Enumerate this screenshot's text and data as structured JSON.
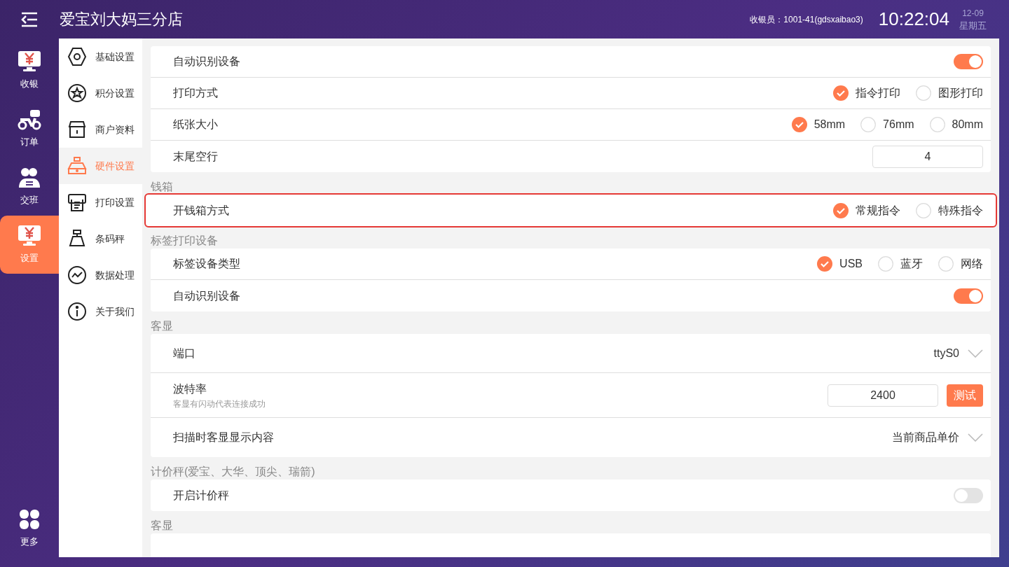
{
  "header": {
    "store_name": "爱宝刘大妈三分店",
    "cashier": "收银员：1001-41(gdsxaibao3)",
    "time": "10:22:04",
    "date": "12-09",
    "weekday": "星期五"
  },
  "rail": [
    {
      "label": "收银",
      "selected": false
    },
    {
      "label": "订单",
      "selected": false
    },
    {
      "label": "交班",
      "selected": false
    },
    {
      "label": "设置",
      "selected": true
    },
    {
      "label": "更多",
      "selected": false
    }
  ],
  "settings_nav": [
    {
      "label": "基础设置",
      "selected": false
    },
    {
      "label": "积分设置",
      "selected": false
    },
    {
      "label": "商户资料",
      "selected": false
    },
    {
      "label": "硬件设置",
      "selected": true
    },
    {
      "label": "打印设置",
      "selected": false
    },
    {
      "label": "条码秤",
      "selected": false
    },
    {
      "label": "数据处理",
      "selected": false
    },
    {
      "label": "关于我们",
      "selected": false
    }
  ],
  "sections": [
    {
      "highlighted": false,
      "rows": [
        {
          "kind": "toggle",
          "label": "自动识别设备",
          "on": true
        },
        {
          "kind": "radio",
          "label": "打印方式",
          "options": [
            {
              "label": "指令打印",
              "selected": true
            },
            {
              "label": "图形打印",
              "selected": false
            }
          ]
        },
        {
          "kind": "radio",
          "label": "纸张大小",
          "options": [
            {
              "label": "58mm",
              "selected": true
            },
            {
              "label": "76mm",
              "selected": false
            },
            {
              "label": "80mm",
              "selected": false
            }
          ]
        },
        {
          "kind": "input",
          "label": "末尾空行",
          "value": "4"
        }
      ]
    },
    {
      "title": "钱箱",
      "highlighted": true,
      "rows": [
        {
          "kind": "radio",
          "label": "开钱箱方式",
          "options": [
            {
              "label": "常规指令",
              "selected": true
            },
            {
              "label": "特殊指令",
              "selected": false
            }
          ]
        }
      ]
    },
    {
      "title": "标签打印设备",
      "highlighted": false,
      "rows": [
        {
          "kind": "radio",
          "label": "标签设备类型",
          "options": [
            {
              "label": "USB",
              "selected": true
            },
            {
              "label": "蓝牙",
              "selected": false
            },
            {
              "label": "网络",
              "selected": false
            }
          ]
        },
        {
          "kind": "toggle",
          "label": "自动识别设备",
          "on": true
        }
      ]
    },
    {
      "title": "客显",
      "highlighted": false,
      "rows": [
        {
          "kind": "select",
          "label": "端口",
          "value": "ttyS0"
        },
        {
          "kind": "input_button",
          "label": "波特率",
          "hint": "客显有闪动代表连接成功",
          "value": "2400",
          "button": "测试"
        },
        {
          "kind": "select",
          "label": "扫描时客显显示内容",
          "value": "当前商品单价"
        }
      ]
    },
    {
      "title": "计价秤(爱宝、大华、顶尖、瑞箭)",
      "highlighted": false,
      "rows": [
        {
          "kind": "toggle",
          "label": "开启计价秤",
          "on": false
        }
      ]
    },
    {
      "title": "客显",
      "highlighted": false
    }
  ]
}
